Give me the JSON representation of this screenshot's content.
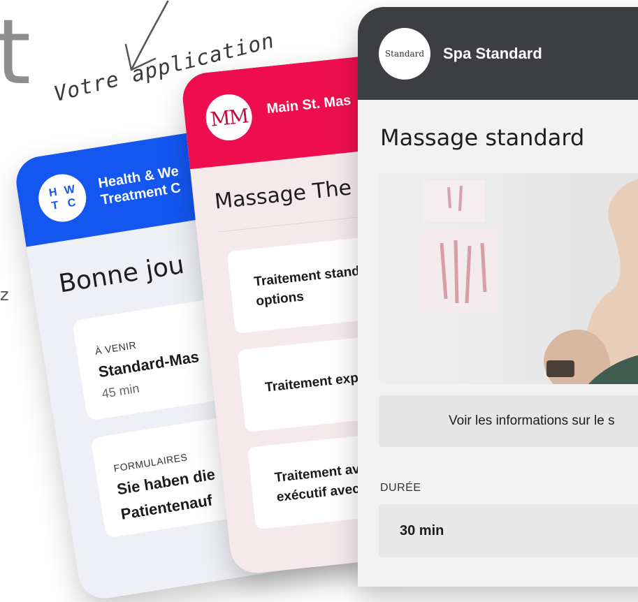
{
  "background": {
    "large_letter": "t",
    "side_letter": "z",
    "handwritten_note": "Votre application"
  },
  "phones": [
    {
      "id": "health-wellness",
      "accent": "#1356f0",
      "logo_text": "HWTC",
      "logo_letters": [
        "H",
        "W",
        "T",
        "C"
      ],
      "business_name_line1": "Health & We",
      "business_name_line2": "Treatment C",
      "greeting": "Bonne jou",
      "cards": [
        {
          "kicker": "À VENIR",
          "title": "Standard-Mas",
          "subtitle": "45 min"
        },
        {
          "kicker": "FORMULAIRES",
          "title": "Sie haben die",
          "subtitle": "Patientenauf"
        }
      ]
    },
    {
      "id": "main-st",
      "accent": "#ee0e4d",
      "logo_text": "MM",
      "business_name": "Main St. Mas",
      "page_title": "Massage The",
      "services": [
        {
          "line1": "Traitement stand",
          "line2": "options"
        },
        {
          "line1": "Traitement expr"
        },
        {
          "line1": "Traitement ava",
          "line2": "exécutif avec c"
        }
      ]
    },
    {
      "id": "spa-standard",
      "accent": "#3c3e41",
      "logo_text": "Standard",
      "business_name": "Spa Standard",
      "page_title": "Massage standard",
      "info_button": "Voir les informations sur le s",
      "duration_label": "DURÉE",
      "duration_option": "30 min"
    }
  ]
}
